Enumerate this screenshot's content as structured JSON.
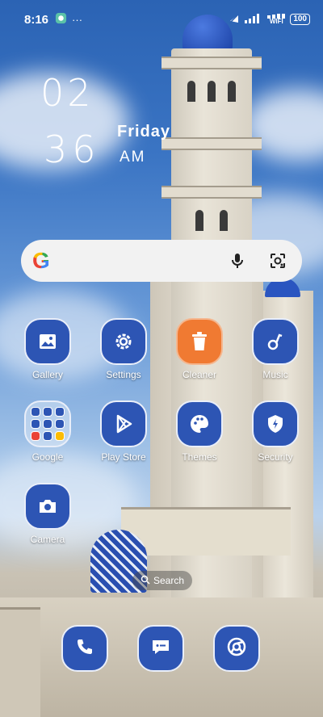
{
  "status_bar": {
    "time": "8:16",
    "network_label": "WIFI",
    "battery": "100"
  },
  "clock": {
    "hour": "02",
    "minute": "36",
    "day": "Friday",
    "ampm": "AM"
  },
  "search_bar": {
    "logo": "G"
  },
  "apps": [
    {
      "label": "Gallery",
      "icon": "image-icon"
    },
    {
      "label": "Settings",
      "icon": "gear-icon"
    },
    {
      "label": "Cleaner",
      "icon": "trash-icon"
    },
    {
      "label": "Music",
      "icon": "music-note-icon"
    },
    {
      "label": "Google",
      "icon": "folder-icon"
    },
    {
      "label": "Play Store",
      "icon": "play-icon"
    },
    {
      "label": "Themes",
      "icon": "palette-icon"
    },
    {
      "label": "Security",
      "icon": "shield-icon"
    },
    {
      "label": "Camera",
      "icon": "camera-icon"
    }
  ],
  "home_search": {
    "label": "Search"
  },
  "dock": [
    {
      "icon": "phone-icon"
    },
    {
      "icon": "message-icon"
    },
    {
      "icon": "browser-icon"
    }
  ],
  "colors": {
    "icon_bg": "#2d55b4",
    "cleaner_bg": "#f07a32",
    "search_bg": "#f2f2f2"
  }
}
